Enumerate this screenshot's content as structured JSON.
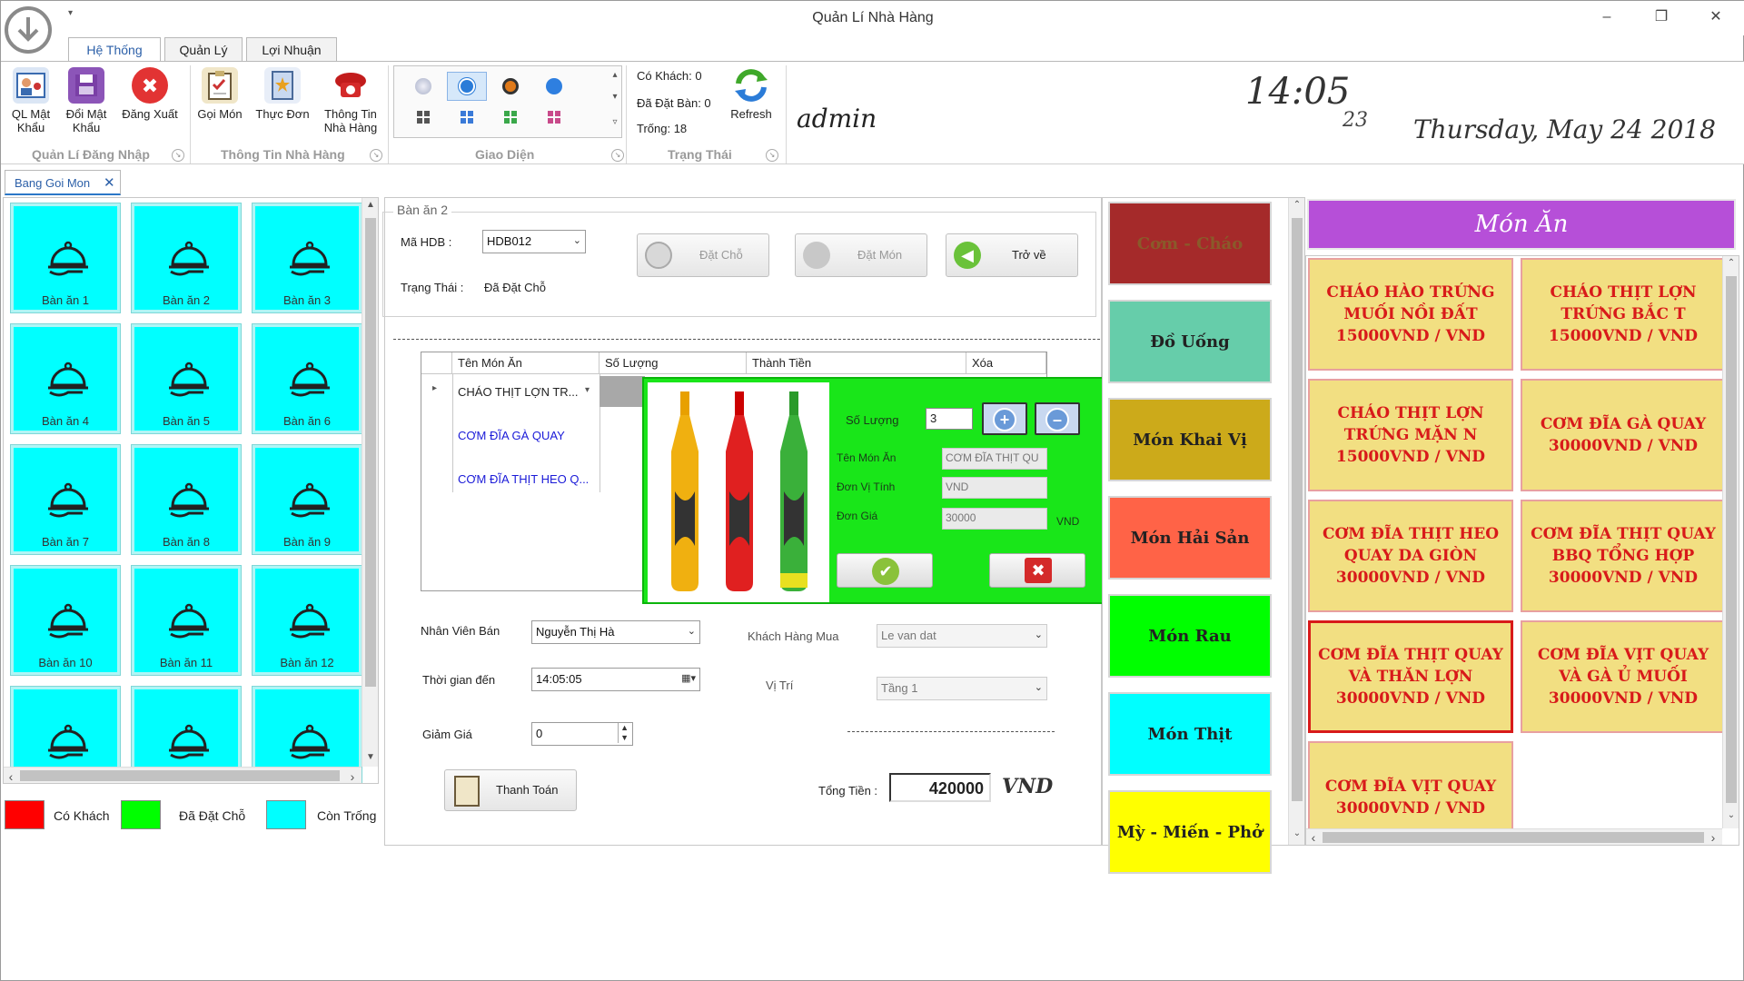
{
  "window": {
    "title": "Quản Lí Nhà Hàng"
  },
  "ribbon_tabs": [
    {
      "label": "Hệ Thống",
      "active": true
    },
    {
      "label": "Quản Lý",
      "active": false
    },
    {
      "label": "Lợi Nhuận",
      "active": false
    }
  ],
  "ribbon": {
    "buttons": [
      {
        "label_1": "QL Mật",
        "label_2": "Khẩu",
        "icon": "users-key-icon"
      },
      {
        "label_1": "Đổi Mật",
        "label_2": "Khẩu",
        "icon": "save-icon"
      },
      {
        "label_1": "Đăng Xuất",
        "label_2": "",
        "icon": "logout-x-icon"
      },
      {
        "label_1": "Gọi Món",
        "label_2": "",
        "icon": "clipboard-order-icon"
      },
      {
        "label_1": "Thực Đơn",
        "label_2": "",
        "icon": "menu-book-icon"
      },
      {
        "label_1": "Thông Tin",
        "label_2": "Nhà Hàng",
        "icon": "phone-info-icon"
      }
    ],
    "groups": [
      "Quản Lí Đăng Nhập",
      "Thông Tin Nhà Hàng",
      "Giao Diện",
      "Trạng Thái"
    ],
    "status": {
      "co_khach": "Có Khách: 0",
      "da_dat_ban": "Đã Đặt Bàn: 0",
      "trong": "Trống: 18"
    },
    "refresh_label": "Refresh",
    "user": "admin",
    "clock_hm": "14:05",
    "clock_sec": "23",
    "date": "Thursday,  May 24 2018"
  },
  "doc_tab": {
    "label": "Bang Goi Mon"
  },
  "tables": [
    {
      "label": "Bàn ăn 1"
    },
    {
      "label": "Bàn ăn 2"
    },
    {
      "label": "Bàn ăn 3"
    },
    {
      "label": "Bàn ăn 4"
    },
    {
      "label": "Bàn ăn 5"
    },
    {
      "label": "Bàn ăn 6"
    },
    {
      "label": "Bàn ăn 7"
    },
    {
      "label": "Bàn ăn 8"
    },
    {
      "label": "Bàn ăn 9"
    },
    {
      "label": "Bàn ăn 10"
    },
    {
      "label": "Bàn ăn 11"
    },
    {
      "label": "Bàn ăn 12"
    },
    {
      "label": ""
    },
    {
      "label": ""
    },
    {
      "label": ""
    }
  ],
  "legend": [
    {
      "label": "Có Khách",
      "color": "#ff0000"
    },
    {
      "label": "Đã Đặt Chỗ",
      "color": "#00ff00"
    },
    {
      "label": "Còn Trống",
      "color": "#00ffff"
    }
  ],
  "order": {
    "section_title": "Bàn ăn 2",
    "ma_hdb_label": "Mã HDB :",
    "ma_hdb_value": "HDB012",
    "trang_thai_label": "Trạng Thái :",
    "trang_thai_value": "Đã Đặt Chỗ",
    "btn_dat_cho": "Đặt Chỗ",
    "btn_dat_mon": "Đặt Món",
    "btn_tro_ve": "Trở về"
  },
  "grid": {
    "columns": [
      "Tên Món Ăn",
      "Số Lượng",
      "Thành Tiền",
      "Xóa"
    ],
    "rows": [
      {
        "name": "CHÁO THỊT LỢN TR..."
      },
      {
        "name": "CƠM ĐĨA GÀ QUAY"
      },
      {
        "name": "CƠM ĐĨA THỊT HEO Q..."
      }
    ]
  },
  "popup": {
    "so_luong_label": "Số Lượng",
    "so_luong_value": "3",
    "ten_mon_label": "Tên Món Ăn",
    "ten_mon_value": "CƠM ĐĨA THỊT QU",
    "don_vi_label": "Đơn Vị Tính",
    "don_vi_value": "VND",
    "don_gia_label": "Đơn Giá",
    "don_gia_value": "30000",
    "don_gia_unit": "VND"
  },
  "form": {
    "nhan_vien_label": "Nhân Viên Bán",
    "nhan_vien_value": "Nguyễn Thị Hà",
    "khach_hang_label": "Khách Hàng Mua",
    "khach_hang_value": "Le van dat",
    "thoi_gian_label": "Thời gian đến",
    "thoi_gian_value": "14:05:05",
    "vi_tri_label": "Vị Trí",
    "vi_tri_value": "Tầng 1",
    "giam_gia_label": "Giảm Giá",
    "giam_gia_value": "0",
    "thanh_toan_label": "Thanh Toán",
    "tong_tien_label": "Tổng Tiền :",
    "tong_tien_value": "420000",
    "currency": "VND"
  },
  "categories": [
    {
      "label": "Cơm - Cháo",
      "color": "#a52a2a",
      "text_color": "#8a5a2a"
    },
    {
      "label": "Đồ Uống",
      "color": "#66cdaa",
      "text_color": "#222222"
    },
    {
      "label": "Món Khai Vị",
      "color": "#ccaa1a",
      "text_color": "#222222"
    },
    {
      "label": "Món Hải Sản",
      "color": "#ff6347",
      "text_color": "#222222"
    },
    {
      "label": "Món Rau",
      "color": "#00ff00",
      "text_color": "#222222"
    },
    {
      "label": "Món Thịt",
      "color": "#00ffff",
      "text_color": "#222222"
    },
    {
      "label": "Mỳ - Miến - Phở",
      "color": "#ffff00",
      "text_color": "#222222"
    }
  ],
  "menu": {
    "title": "Món Ăn",
    "dishes": [
      {
        "l1": "CHÁO HÀO TRỨNG",
        "l2": "MUỐI NỒI ĐẤT",
        "l3": "15000VND / VND"
      },
      {
        "l1": "CHÁO THỊT LỢN",
        "l2": "TRỨNG BẮC T",
        "l3": "15000VND / VND"
      },
      {
        "l1": "CHÁO THỊT LỢN",
        "l2": "TRỨNG MẶN N",
        "l3": "15000VND / VND"
      },
      {
        "l1": "CƠM ĐĨA GÀ QUAY",
        "l2": "30000VND / VND",
        "l3": ""
      },
      {
        "l1": "CƠM ĐĨA THỊT HEO",
        "l2": "QUAY DA GIÒN",
        "l3": "30000VND / VND"
      },
      {
        "l1": "CƠM ĐĨA THỊT QUAY",
        "l2": "BBQ TỔNG HỢP",
        "l3": "30000VND / VND"
      },
      {
        "l1": "CƠM ĐĨA THỊT QUAY",
        "l2": "VÀ THĂN LỢN",
        "l3": "30000VND / VND"
      },
      {
        "l1": "CƠM ĐĨA VỊT QUAY",
        "l2": "VÀ GÀ Ủ MUỐI",
        "l3": "30000VND / VND"
      },
      {
        "l1": "CƠM ĐĨA VỊT QUAY",
        "l2": "30000VND / VND",
        "l3": ""
      }
    ]
  }
}
